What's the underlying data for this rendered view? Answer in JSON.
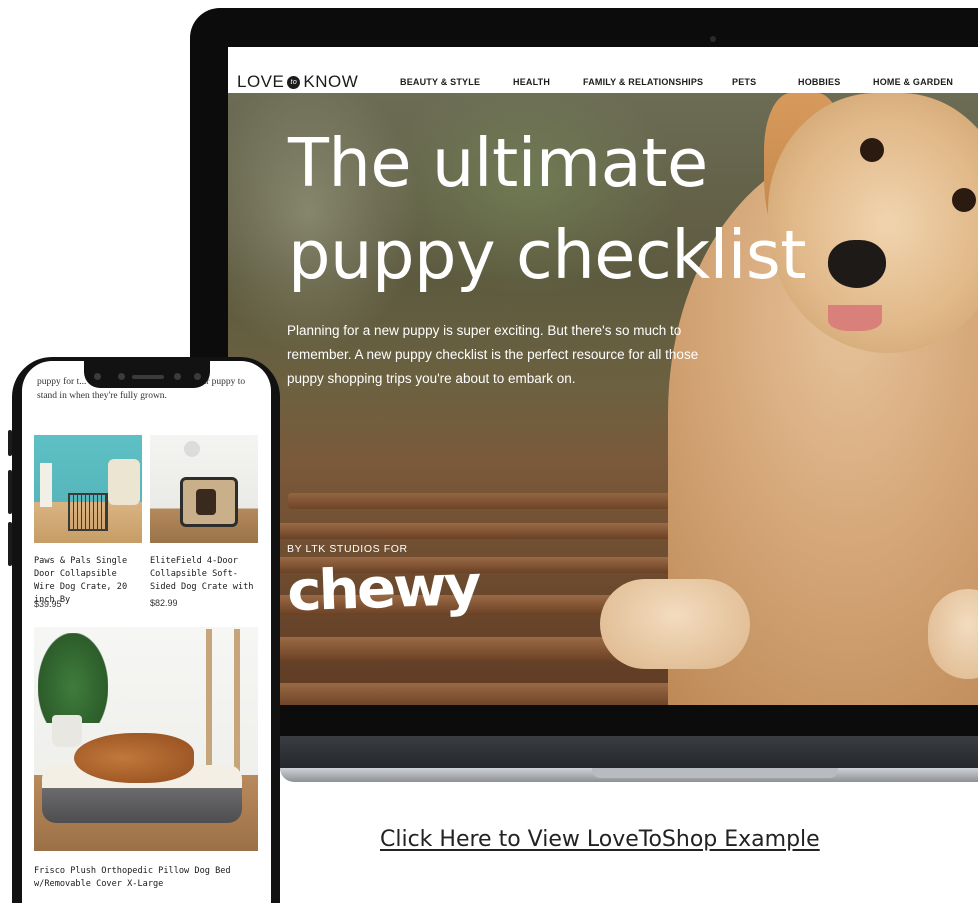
{
  "laptop_page": {
    "logo": {
      "left": "LOVE",
      "badge": "to",
      "right": "KNOW"
    },
    "nav_items": [
      "BEAUTY & STYLE",
      "HEALTH",
      "FAMILY & RELATIONSHIPS",
      "PETS",
      "HOBBIES",
      "HOME & GARDEN"
    ],
    "headline_line1": "The ultimate",
    "headline_line2": "puppy checklist",
    "intro": "Planning for a new puppy is super exciting. But there's so much to remember. A new puppy checklist is the perfect resource for all those puppy shopping trips you're about to embark on.",
    "byline": "BY LTK STUDIOS FOR",
    "brand_logo": "chewy"
  },
  "phone_page": {
    "intro_text": "puppy for t... ...at will be big enough for your puppy to stand in when they're fully grown.",
    "products": [
      {
        "title": "Paws & Pals Single Door Collapsible Wire Dog Crate, 20 inch By",
        "price": "$39.95"
      },
      {
        "title": "EliteField 4-Door Collapsible Soft-Sided Dog Crate with",
        "price": "$82.99"
      },
      {
        "title": "Frisco Plush Orthopedic Pillow Dog Bed w/Removable Cover X-Large",
        "price": ""
      }
    ]
  },
  "cta_link": "Click Here to View LoveToShop Example",
  "colors": {
    "nav_bg": "#ffffff",
    "hero_text": "#ffffff",
    "cta_text": "#222222"
  }
}
